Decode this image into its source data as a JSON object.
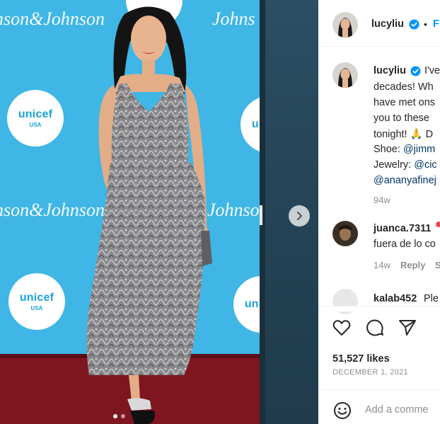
{
  "photo": {
    "backdrop_brand": "Johnson",
    "backdrop_brand_full": "Johnson&Johnson",
    "unicef_name": "unicef",
    "unicef_sub": "USA",
    "colors": {
      "backdrop": "#3fb6e6",
      "carpet": "#7e1620"
    },
    "carousel_dots": 2,
    "active_dot": 1,
    "next_icon": "chevron-right-icon"
  },
  "post": {
    "username": "lucyliu",
    "follow_separator": "•",
    "follow_label": "F",
    "caption_lines": [
      {
        "pre": "I've",
        "link": ""
      },
      {
        "pre": "decades! Wh",
        "link": ""
      },
      {
        "pre": "have met ons",
        "link": ""
      },
      {
        "pre": "you to these",
        "link": ""
      },
      {
        "pre": "tonight! 🙏 D",
        "link": ""
      },
      {
        "pre": "Shoe: ",
        "link": "@jimm"
      },
      {
        "pre": "Jewelry: ",
        "link": "@cic"
      },
      {
        "pre": "",
        "link": "@ananyafinej"
      }
    ],
    "caption_age": "94w",
    "comments": [
      {
        "username": "juanca.7311",
        "text": "fuera de lo co",
        "age": "14w",
        "reply_label": "Reply",
        "extra": "S"
      },
      {
        "username": "kalab452",
        "text": "Ple"
      }
    ],
    "likes": "51,527 likes",
    "date": "DECEMBER 1, 2021",
    "add_comment_placeholder": "Add a comme",
    "colors": {
      "link": "#00376b",
      "follow": "#0095f6",
      "verified": "#0095f6",
      "text": "#262626",
      "muted": "#8e8e8e"
    }
  }
}
